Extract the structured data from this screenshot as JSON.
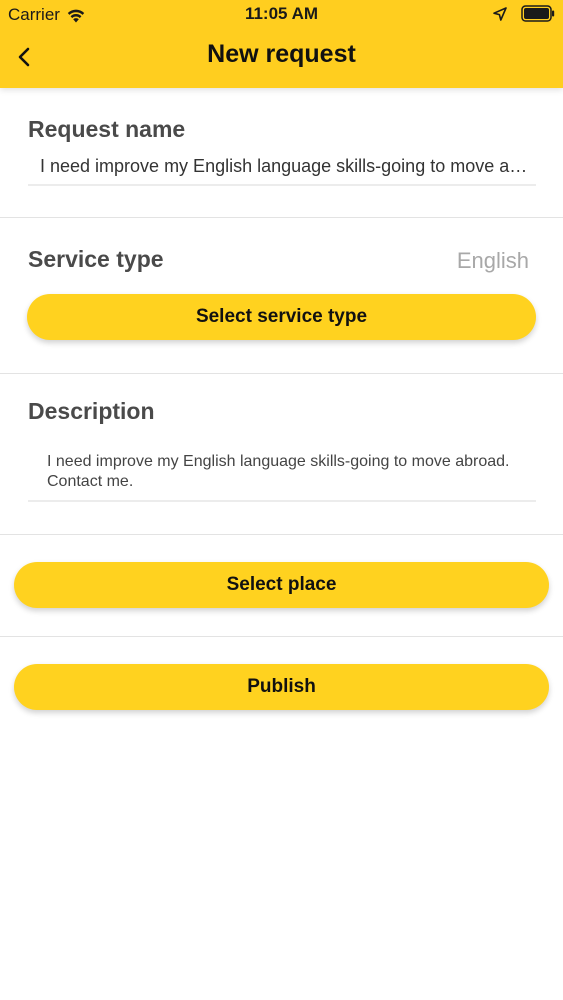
{
  "status_bar": {
    "carrier": "Carrier",
    "time": "11:05 AM",
    "icons": [
      "wifi-icon",
      "location-arrow-icon",
      "battery-icon"
    ]
  },
  "nav": {
    "back_icon": "chevron-left-icon",
    "title": "New request"
  },
  "request_name": {
    "label": "Request name",
    "value": "I need improve my English language skills-going to move abroad. Contact me."
  },
  "service_type": {
    "label": "Service type",
    "value": "English",
    "button_label": "Select service type"
  },
  "description": {
    "label": "Description",
    "value": "I need improve my English language skills-going to move abroad. Contact me."
  },
  "actions": {
    "select_place_label": "Select place",
    "publish_label": "Publish"
  },
  "colors": {
    "accent": "#FFD21F",
    "header": "#FFCE1F",
    "label": "#4A4A4A",
    "muted": "#A8A8A8"
  }
}
